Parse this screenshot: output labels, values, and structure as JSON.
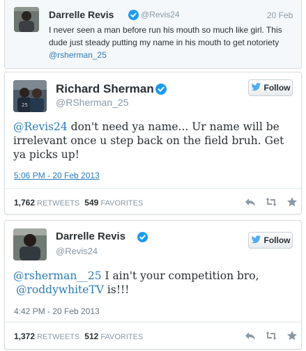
{
  "tweet_reply": {
    "name": "Darrelle Revis",
    "handle": "@Revis24",
    "date": "20 Feb",
    "text_before": "I never seen a man before run his mouth so much like girl. This dude just steady putting my name in his mouth to get notoriety ",
    "mention": "@rsherman_25"
  },
  "tweet_main": {
    "name": "Richard Sherman",
    "handle": "@RSherman_25",
    "follow_label": "Follow",
    "mention": "@Revis24",
    "text_after": " don't need ya name... Ur name will be irrelevant once u step back on the field bruh.  Get ya picks up!",
    "timestamp": "5:06 PM - 20 Feb 2013",
    "retweets": "1,762",
    "retweets_label": "RETWEETS",
    "favorites": "549",
    "favorites_label": "FAVORITES"
  },
  "tweet_third": {
    "name": "Darrelle Revis",
    "handle": "@Revis24",
    "follow_label": "Follow",
    "mention1": "@rsherman__25",
    "text_middle": " I ain't your competition bro,",
    "mention2": "@roddywhiteTV",
    "text_end": " is!!!",
    "timestamp": "4:42 PM - 20 Feb 2013",
    "retweets": "1,372",
    "retweets_label": "RETWEETS",
    "favorites": "512",
    "favorites_label": "FAVORITES"
  },
  "colors": {
    "link": "#2b7bb9",
    "verified": "#1d9bf0",
    "muted": "#8899a6"
  },
  "icons": [
    "verified-badge-icon",
    "twitter-bird-icon",
    "reply-icon",
    "retweet-icon",
    "favorite-star-icon"
  ]
}
